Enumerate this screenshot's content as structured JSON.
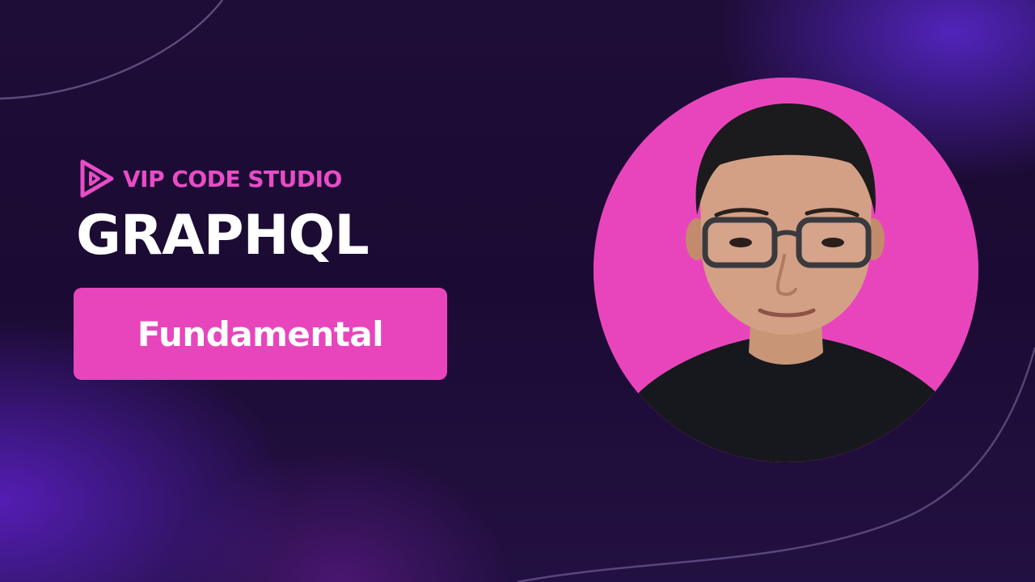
{
  "brand": {
    "name": "VIP CODE STUDIO",
    "logo_icon": "play-logo-icon",
    "color": "#e84cc6"
  },
  "course": {
    "title": "GRAPHQL",
    "subtitle": "Fundamental"
  },
  "portrait": {
    "icon": "presenter-portrait",
    "background_color": "#e845bd"
  },
  "theme": {
    "background": "#1e0d36",
    "accent": "#e845bd",
    "glow": "#5c20c8"
  }
}
